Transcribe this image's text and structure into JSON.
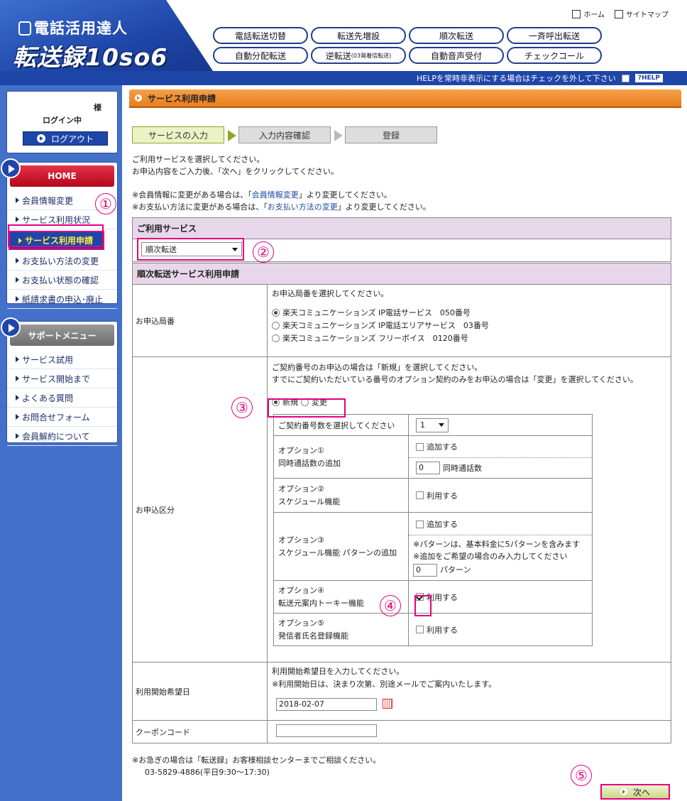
{
  "header": {
    "logo_title": "電話活用達人",
    "logo_sub": "転送録10so6",
    "links": {
      "home": "ホーム",
      "sitemap": "サイトマップ"
    },
    "nav": [
      "電話転送切替",
      "転送先増設",
      "順次転送",
      "一斉呼出転送",
      "自動分配転送",
      "逆転送",
      "自動音声受付",
      "チェックコール"
    ],
    "nav_reverse_small": "(03発着信転送)",
    "help_text": "HELPを常時非表示にする場合はチェックを外して下さい",
    "help_button": "?HELP"
  },
  "sidebar": {
    "sama": "様",
    "login": "ログイン中",
    "logout": "ログアウト",
    "home_title": "HOME",
    "home_items": [
      "会員情報変更",
      "サービス利用状況",
      "サービス利用申請",
      "お支払い方法の変更",
      "お支払い状態の確認",
      "紙請求書の申込･廃止"
    ],
    "support_title": "サポートメニュー",
    "support_items": [
      "サービス試用",
      "サービス開始まで",
      "よくある質問",
      "お問合せフォーム",
      "会員解約について"
    ]
  },
  "main": {
    "title": "サービス利用申請",
    "steps": [
      "サービスの入力",
      "入力内容確認",
      "登録"
    ],
    "intro": [
      "ご利用サービスを選択してください。",
      "お申込内容をご入力後、「次へ」をクリックしてください。"
    ],
    "notes": {
      "l1_a": "※会員情報に変更がある場合は、「",
      "l1_link": "会員情報変更",
      "l1_b": "」より変更してください。",
      "l2_a": "※お支払い方法に変更がある場合は、「",
      "l2_link": "お支払い方法の変更",
      "l2_b": "」より変更してください。"
    },
    "service_header": "ご利用サービス",
    "service_value": "順次転送",
    "apply_header": "順次転送サービス利用申請",
    "office": {
      "label": "お申込局番",
      "prompt": "お申込局番を選択してください。",
      "options": [
        "楽天コミュニケーションズ IP電話サービス　050番号",
        "楽天コミュニケーションズ IP電話エリアサービス　03番号",
        "楽天コミュニケーションズ フリーボイス　0120番号"
      ]
    },
    "kubun": {
      "label": "お申込区分",
      "prompt1": "ご契約番号のお申込の場合は「新規」を選択してください。",
      "prompt2": "すでにご契約いただいている番号のオプション契約のみをお申込の場合は「変更」を選択してください。",
      "new": "新規",
      "change": "変更",
      "count_label": "ご契約番号数を選択してください",
      "count_value": "1",
      "opt1_title": "オプション①",
      "opt1_desc": "同時通話数の追加",
      "opt1_check": "追加する",
      "opt1_qty": "0",
      "opt1_unit": "同時通話数",
      "opt2_title": "オプション②",
      "opt2_desc": "スケジュール機能",
      "opt2_check": "利用する",
      "opt3_title": "オプション③",
      "opt3_desc": "スケジュール機能 パターンの追加",
      "opt3_check": "追加する",
      "opt3_note1": "※パターンは、基本料金に5パターンを含みます",
      "opt3_note2": "※追加をご希望の場合のみ入力してください",
      "opt3_qty": "0",
      "opt3_unit": "パターン",
      "opt4_title": "オプション④",
      "opt4_desc": "転送元案内トーキー機能",
      "opt4_check": "利用する",
      "opt5_title": "オプション⑤",
      "opt5_desc": "発信者氏名登録機能",
      "opt5_check": "利用する"
    },
    "start": {
      "label": "利用開始希望日",
      "prompt1": "利用開始希望日を入力してください。",
      "prompt2": "※利用開始日は、決まり次第、別途メールでご案内いたします。",
      "date": "2018-02-07"
    },
    "coupon": {
      "label": "クーポンコード",
      "value": ""
    },
    "footer1": "※お急ぎの場合は「転送録」お客様相談センターまでご相談ください。",
    "footer2": "03-5829-4886(平日9:30～17:30)",
    "next": "次へ"
  },
  "annotations": [
    "①",
    "②",
    "③",
    "④",
    "⑤"
  ],
  "colors": {
    "brand": "#1e46a8",
    "accent": "#e6007e",
    "title_bar": "#e87d1c"
  }
}
